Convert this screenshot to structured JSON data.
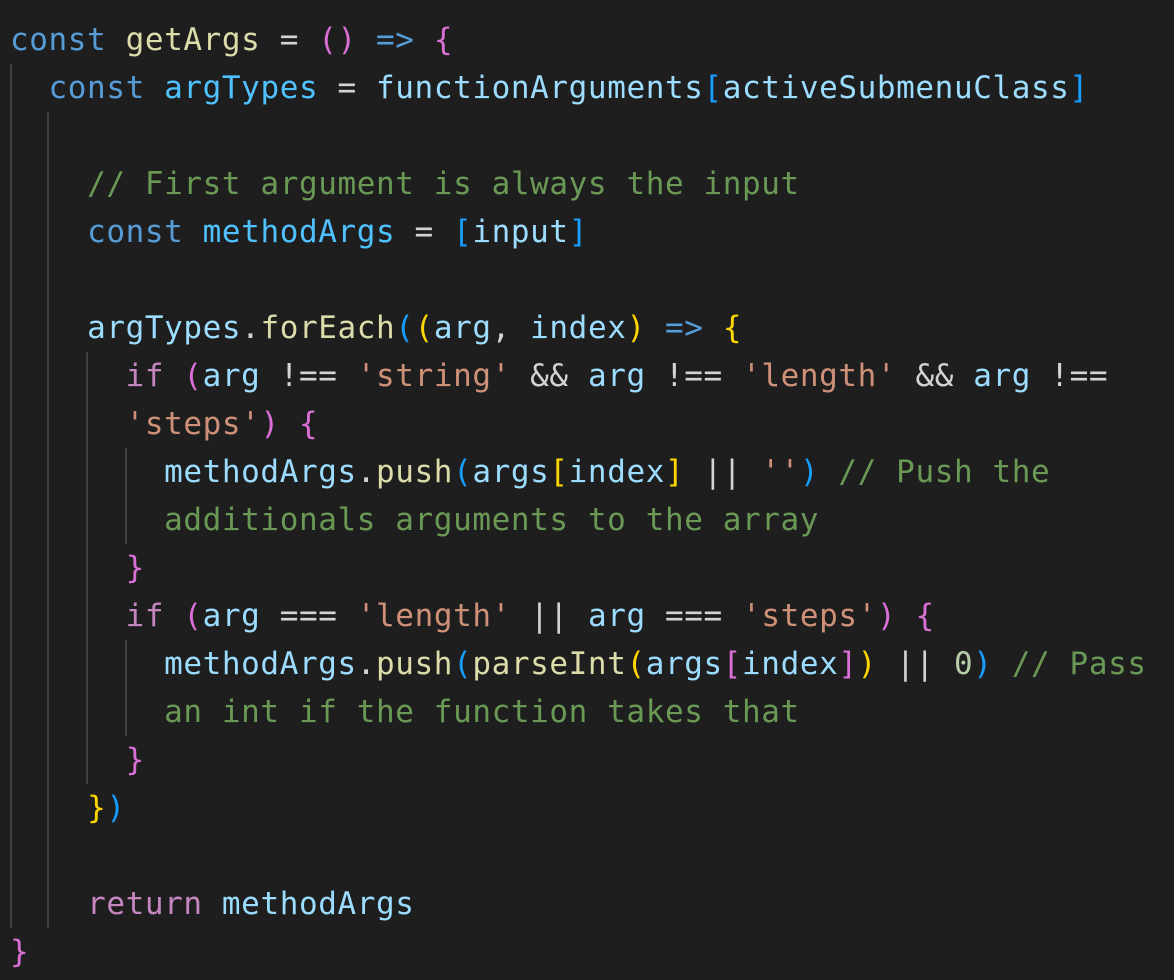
{
  "editor": {
    "theme": "dark",
    "colors": {
      "background": "#1e1e1e",
      "keyword": "#569cd6",
      "control": "#c586c0",
      "variable": "#9cdcfe",
      "constant": "#4fc1ff",
      "function": "#dcdcaa",
      "string": "#ce9178",
      "number": "#b5cea8",
      "comment": "#6a9955",
      "bracket_1": "#ffd700",
      "bracket_2": "#da70d6",
      "bracket_3": "#179fff"
    },
    "lines": [
      [
        [
          "kw",
          "const"
        ],
        [
          "op",
          " "
        ],
        [
          "fn",
          "getArgs"
        ],
        [
          "op",
          " = "
        ],
        [
          "b2",
          "()"
        ],
        [
          "op",
          " "
        ],
        [
          "kw",
          "=>"
        ],
        [
          "op",
          " "
        ],
        [
          "b2",
          "{"
        ]
      ],
      [
        [
          "op",
          "  "
        ],
        [
          "kw",
          "const"
        ],
        [
          "op",
          " "
        ],
        [
          "cn",
          "argTypes"
        ],
        [
          "op",
          " = "
        ],
        [
          "vr",
          "functionArguments"
        ],
        [
          "b3",
          "["
        ],
        [
          "vr",
          "activeSubmenuClass"
        ],
        [
          "b3",
          "]"
        ]
      ],
      [
        [
          "op",
          ""
        ]
      ],
      [
        [
          "op",
          "    "
        ],
        [
          "com",
          "// First argument is always the input"
        ]
      ],
      [
        [
          "op",
          "    "
        ],
        [
          "kw",
          "const"
        ],
        [
          "op",
          " "
        ],
        [
          "cn",
          "methodArgs"
        ],
        [
          "op",
          " = "
        ],
        [
          "b3",
          "["
        ],
        [
          "vr",
          "input"
        ],
        [
          "b3",
          "]"
        ]
      ],
      [
        [
          "op",
          ""
        ]
      ],
      [
        [
          "op",
          "    "
        ],
        [
          "vr",
          "argTypes"
        ],
        [
          "op",
          "."
        ],
        [
          "fn",
          "forEach"
        ],
        [
          "b3",
          "("
        ],
        [
          "b1",
          "("
        ],
        [
          "vr",
          "arg"
        ],
        [
          "op",
          ", "
        ],
        [
          "vr",
          "index"
        ],
        [
          "b1",
          ")"
        ],
        [
          "op",
          " "
        ],
        [
          "kw",
          "=>"
        ],
        [
          "op",
          " "
        ],
        [
          "b1",
          "{"
        ]
      ],
      [
        [
          "op",
          "      "
        ],
        [
          "ctrl",
          "if"
        ],
        [
          "op",
          " "
        ],
        [
          "b2",
          "("
        ],
        [
          "vr",
          "arg"
        ],
        [
          "op",
          " !== "
        ],
        [
          "str",
          "'string'"
        ],
        [
          "op",
          " && "
        ],
        [
          "vr",
          "arg"
        ],
        [
          "op",
          " !== "
        ],
        [
          "str",
          "'length'"
        ],
        [
          "op",
          " && "
        ],
        [
          "vr",
          "arg"
        ],
        [
          "op",
          " !=="
        ]
      ],
      [
        [
          "op",
          "      "
        ],
        [
          "str",
          "'steps'"
        ],
        [
          "b2",
          ")"
        ],
        [
          "op",
          " "
        ],
        [
          "b2",
          "{"
        ]
      ],
      [
        [
          "op",
          "        "
        ],
        [
          "vr",
          "methodArgs"
        ],
        [
          "op",
          "."
        ],
        [
          "fn",
          "push"
        ],
        [
          "b3",
          "("
        ],
        [
          "vr",
          "args"
        ],
        [
          "b1",
          "["
        ],
        [
          "vr",
          "index"
        ],
        [
          "b1",
          "]"
        ],
        [
          "op",
          " || "
        ],
        [
          "str",
          "''"
        ],
        [
          "b3",
          ")"
        ],
        [
          "op",
          " "
        ],
        [
          "com",
          "// Push the"
        ]
      ],
      [
        [
          "op",
          "        "
        ],
        [
          "com",
          "additionals arguments to the array"
        ]
      ],
      [
        [
          "op",
          "      "
        ],
        [
          "b2",
          "}"
        ]
      ],
      [
        [
          "op",
          "      "
        ],
        [
          "ctrl",
          "if"
        ],
        [
          "op",
          " "
        ],
        [
          "b2",
          "("
        ],
        [
          "vr",
          "arg"
        ],
        [
          "op",
          " === "
        ],
        [
          "str",
          "'length'"
        ],
        [
          "op",
          " || "
        ],
        [
          "vr",
          "arg"
        ],
        [
          "op",
          " === "
        ],
        [
          "str",
          "'steps'"
        ],
        [
          "b2",
          ")"
        ],
        [
          "op",
          " "
        ],
        [
          "b2",
          "{"
        ]
      ],
      [
        [
          "op",
          "        "
        ],
        [
          "vr",
          "methodArgs"
        ],
        [
          "op",
          "."
        ],
        [
          "fn",
          "push"
        ],
        [
          "b3",
          "("
        ],
        [
          "fn",
          "parseInt"
        ],
        [
          "b1",
          "("
        ],
        [
          "vr",
          "args"
        ],
        [
          "b2",
          "["
        ],
        [
          "vr",
          "index"
        ],
        [
          "b2",
          "]"
        ],
        [
          "b1",
          ")"
        ],
        [
          "op",
          " || "
        ],
        [
          "num",
          "0"
        ],
        [
          "b3",
          ")"
        ],
        [
          "op",
          " "
        ],
        [
          "com",
          "// Pass"
        ]
      ],
      [
        [
          "op",
          "        "
        ],
        [
          "com",
          "an int if the function takes that"
        ]
      ],
      [
        [
          "op",
          "      "
        ],
        [
          "b2",
          "}"
        ]
      ],
      [
        [
          "op",
          "    "
        ],
        [
          "b1",
          "}"
        ],
        [
          "b3",
          ")"
        ]
      ],
      [
        [
          "op",
          ""
        ]
      ],
      [
        [
          "op",
          "    "
        ],
        [
          "ctrl",
          "return"
        ],
        [
          "op",
          " "
        ],
        [
          "vr",
          "methodArgs"
        ]
      ],
      [
        [
          "b2",
          "}"
        ]
      ]
    ]
  }
}
